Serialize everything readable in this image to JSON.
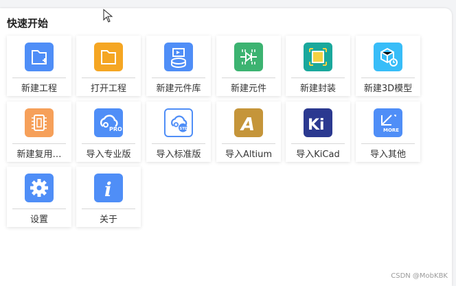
{
  "section_title": "快速开始",
  "tiles": [
    {
      "label": "新建工程",
      "icon": "folder-plus-icon"
    },
    {
      "label": "打开工程",
      "icon": "folder-open-icon"
    },
    {
      "label": "新建元件库",
      "icon": "component-library-icon"
    },
    {
      "label": "新建元件",
      "icon": "diode-component-icon"
    },
    {
      "label": "新建封装",
      "icon": "chip-footprint-icon"
    },
    {
      "label": "新建3D模型",
      "icon": "cube-3d-model-icon"
    },
    {
      "label": "新建复用…",
      "icon": "reuse-chip-icon"
    },
    {
      "label": "导入专业版",
      "icon": "cloud-pro-icon",
      "badge": "PRO"
    },
    {
      "label": "导入标准版",
      "icon": "cloud-std-icon",
      "badge": "STD"
    },
    {
      "label": "导入Altium",
      "icon": "altium-logo-icon",
      "glyph": "A"
    },
    {
      "label": "导入KiCad",
      "icon": "kicad-logo-icon",
      "glyph": "Ki"
    },
    {
      "label": "导入其他",
      "icon": "import-more-icon",
      "badge": "MORE"
    },
    {
      "label": "设置",
      "icon": "gear-icon"
    },
    {
      "label": "关于",
      "icon": "info-icon",
      "glyph": "i"
    }
  ],
  "watermark": "CSDN @MobKBK",
  "colors": {
    "blue": "#3b82f6",
    "orange": "#f5a623",
    "green": "#22a35a",
    "teal": "#1aa89c",
    "cyan": "#38bdf8",
    "peach": "#f6a05a",
    "altium": "#c5953a",
    "kicad": "#2b3990"
  }
}
